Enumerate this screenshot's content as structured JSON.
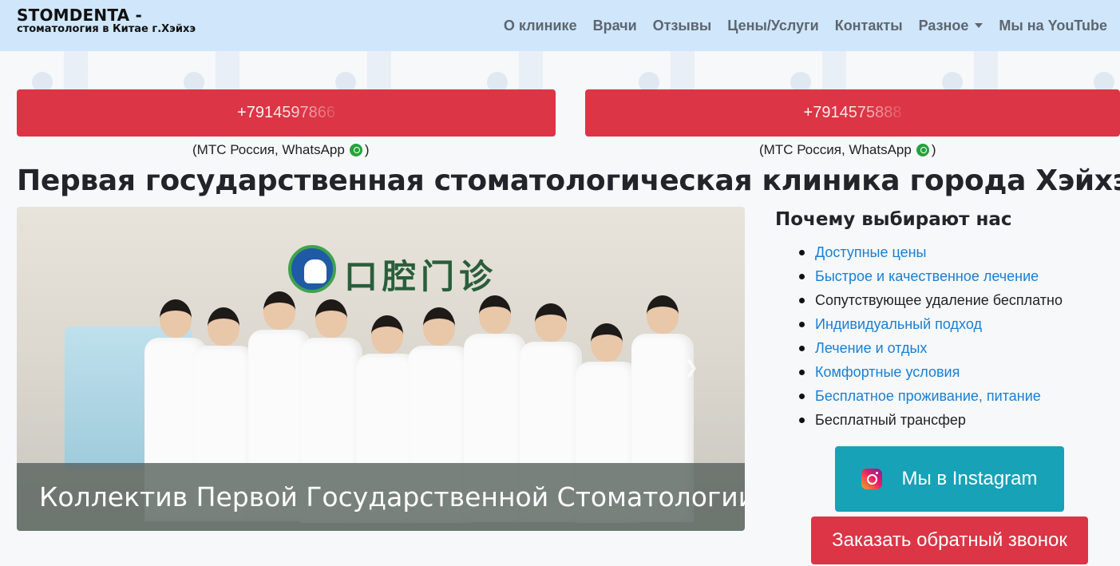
{
  "brand": {
    "title": "STOMDENTA -",
    "subtitle": "стоматология в Китае г.Хэйхэ"
  },
  "nav": {
    "items": [
      "О клинике",
      "Врачи",
      "Отзывы",
      "Цены/Услуги",
      "Контакты",
      "Разное",
      "Мы на YouTube"
    ]
  },
  "phones": [
    {
      "number": "+7914597866",
      "note_left": "(МТС Россия, WhatsApp",
      "note_right": ")"
    },
    {
      "number": "+7914575888",
      "note_left": "(МТС Россия, WhatsApp",
      "note_right": " )"
    }
  ],
  "main_title": "Первая государственная стоматологическая клиника города Хэйхэ",
  "photo": {
    "sign_text": "口腔门诊",
    "caption": "Коллектив Первой Государственной Стоматологии"
  },
  "why": {
    "title": "Почему выбирают нас",
    "items": [
      {
        "label": "Доступные цены",
        "link": true
      },
      {
        "label": "Быстрое и качественное лечение",
        "link": true
      },
      {
        "label": "Сопутствующее удаление бесплатно",
        "link": false
      },
      {
        "label": "Индивидуальный подход",
        "link": true
      },
      {
        "label": "Лечение и отдых",
        "link": true
      },
      {
        "label": "Комфортные условия",
        "link": true
      },
      {
        "label": "Бесплатное проживание, питание",
        "link": true
      },
      {
        "label": "Бесплатный трансфер",
        "link": false
      }
    ]
  },
  "buttons": {
    "instagram": "Мы в Instagram",
    "callback": "Заказать обратный звонок"
  },
  "colors": {
    "navbar_bg": "#cfe6fb",
    "danger": "#dc3545",
    "info": "#17a2b8",
    "link": "#1a7fd4"
  }
}
